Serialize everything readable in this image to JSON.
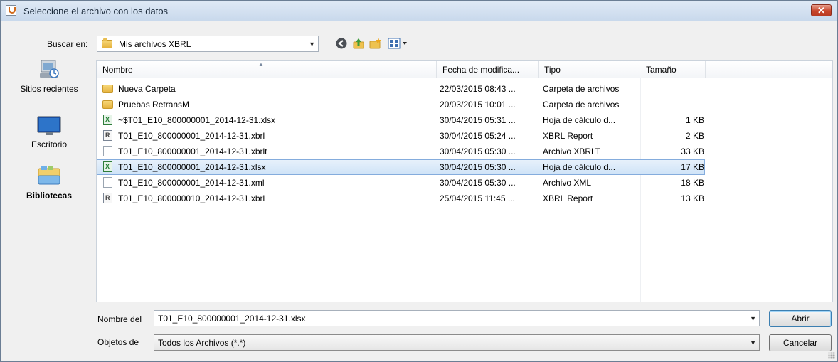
{
  "window": {
    "title": "Seleccione el archivo con los datos",
    "close_glyph": "✕"
  },
  "toolbar": {
    "look_in_label": "Buscar en:",
    "look_in_value": "Mis archivos XBRL",
    "icons": [
      "back-icon",
      "up-folder-icon",
      "new-folder-icon",
      "view-menu-icon"
    ]
  },
  "places": [
    {
      "label": "Sitios recientes",
      "icon": "recent-places-icon"
    },
    {
      "label": "Escritorio",
      "icon": "desktop-icon"
    },
    {
      "label": "Bibliotecas",
      "icon": "libraries-icon"
    }
  ],
  "columns": {
    "name": "Nombre",
    "date": "Fecha de modifica...",
    "type": "Tipo",
    "size": "Tamaño"
  },
  "files": [
    {
      "icon": "folder",
      "name": "Nueva Carpeta",
      "date": "22/03/2015 08:43 ...",
      "type": "Carpeta de archivos",
      "size": ""
    },
    {
      "icon": "folder",
      "name": "Pruebas RetransM",
      "date": "20/03/2015 10:01 ...",
      "type": "Carpeta de archivos",
      "size": ""
    },
    {
      "icon": "xls",
      "name": "~$T01_E10_800000001_2014-12-31.xlsx",
      "date": "30/04/2015 05:31 ...",
      "type": "Hoja de cálculo d...",
      "size": "1 KB"
    },
    {
      "icon": "xbrl",
      "name": "T01_E10_800000001_2014-12-31.xbrl",
      "date": "30/04/2015 05:24 ...",
      "type": "XBRL Report",
      "size": "2 KB"
    },
    {
      "icon": "doc",
      "name": "T01_E10_800000001_2014-12-31.xbrlt",
      "date": "30/04/2015 05:30 ...",
      "type": "Archivo XBRLT",
      "size": "33 KB"
    },
    {
      "icon": "xls",
      "name": "T01_E10_800000001_2014-12-31.xlsx",
      "date": "30/04/2015 05:30 ...",
      "type": "Hoja de cálculo d...",
      "size": "17 KB",
      "selected": true
    },
    {
      "icon": "doc",
      "name": "T01_E10_800000001_2014-12-31.xml",
      "date": "30/04/2015 05:30 ...",
      "type": "Archivo XML",
      "size": "18 KB"
    },
    {
      "icon": "xbrl",
      "name": "T01_E10_800000010_2014-12-31.xbrl",
      "date": "25/04/2015 11:45 ...",
      "type": "XBRL Report",
      "size": "13 KB"
    }
  ],
  "footer": {
    "filename_label": "Nombre del",
    "filename_value": "T01_E10_800000001_2014-12-31.xlsx",
    "filetype_label": "Objetos de",
    "filetype_value": "Todos los Archivos (*.*)",
    "open_button": "Abrir",
    "cancel_button": "Cancelar"
  },
  "colors": {
    "selection_border": "#84acdd",
    "selection_fill": "#cfe3f7",
    "close_button": "#c8452a"
  }
}
